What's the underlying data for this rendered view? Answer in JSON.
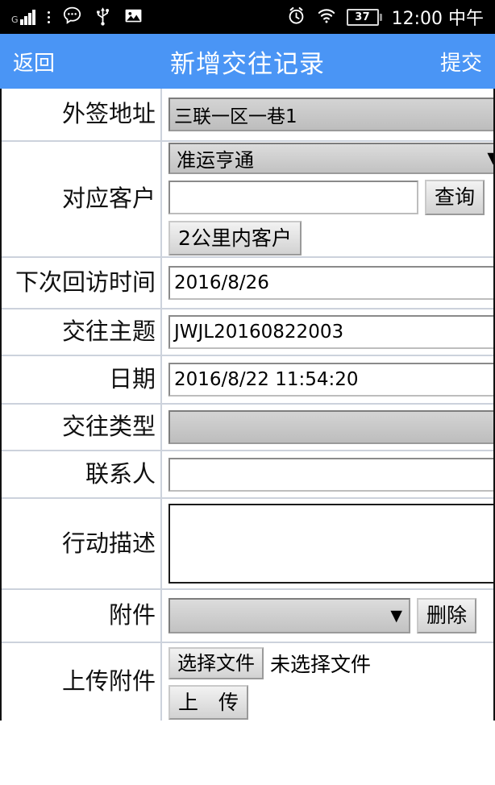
{
  "statusbar": {
    "network_label": "G",
    "signal_icon": "signal-bars-icon",
    "menu_icon": "three-dots-icon",
    "message_icon": "speech-bubble-icon",
    "usb_icon": "usb-icon",
    "image_icon": "image-icon",
    "alarm_icon": "alarm-clock-icon",
    "wifi_icon": "wifi-icon",
    "battery_level": "37",
    "time": "12:00 中午"
  },
  "titlebar": {
    "back_label": "返回",
    "title": "新增交往记录",
    "submit_label": "提交",
    "background_color": "#4a95f5",
    "text_color": "#ffffff"
  },
  "form": {
    "rows": [
      {
        "label": "外签地址",
        "value": "三联一区一巷1"
      },
      {
        "label": "对应客户",
        "select_value": "准运亨通",
        "search_value": "",
        "search_button": "查询",
        "nearby_button": "2公里内客户",
        "dropdown_icon": "chevron-down-icon"
      },
      {
        "label": "下次回访时间",
        "value": "2016/8/26"
      },
      {
        "label": "交往主题",
        "value": "JWJL20160822003"
      },
      {
        "label": "日期",
        "value": "2016/8/22 11:54:20"
      },
      {
        "label": "交往类型",
        "value": ""
      },
      {
        "label": "联系人",
        "value": ""
      },
      {
        "label": "行动描述",
        "value": ""
      },
      {
        "label": "附件",
        "select_value": "",
        "delete_button": "删除",
        "dropdown_icon": "chevron-down-icon"
      },
      {
        "label": "上传附件",
        "choose_button": "选择文件",
        "file_status": "未选择文件",
        "upload_button": "上　传"
      }
    ]
  }
}
